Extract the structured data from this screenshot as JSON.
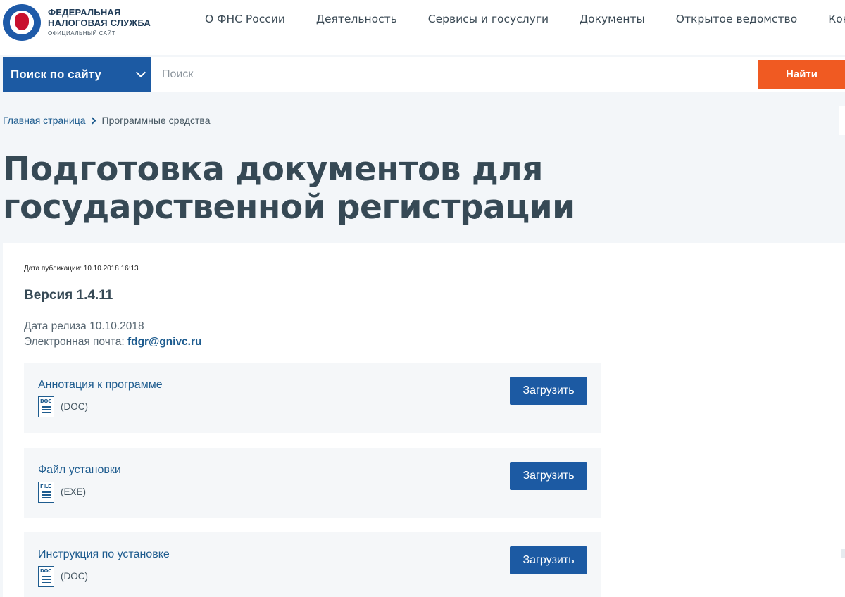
{
  "header": {
    "logo_line1": "ФЕДЕРАЛЬНАЯ",
    "logo_line2": "НАЛОГОВАЯ СЛУЖБА",
    "logo_line3": "ОФИЦИАЛЬНЫЙ САЙТ",
    "nav": [
      "О ФНС России",
      "Деятельность",
      "Сервисы и госуслуги",
      "Документы",
      "Открытое ведомство",
      "Контакты"
    ]
  },
  "search": {
    "scope_label": "Поиск по сайту",
    "placeholder": "Поиск",
    "button_label": "Найти"
  },
  "breadcrumb": {
    "home": "Главная страница",
    "current": "Программные средства"
  },
  "page": {
    "title": "Подготовка документов для государственной регистрации",
    "publication_date": "Дата публикации: 10.10.2018 16:13",
    "version": "Версия 1.4.11",
    "release_date": "Дата релиза 10.10.2018",
    "email_label": "Электронная почта:",
    "email": "fdgr@gnivc.ru"
  },
  "files": [
    {
      "name": "Аннотация к программе",
      "icon_tag": "DOC",
      "ext": "(DOC)",
      "button": "Загрузить"
    },
    {
      "name": "Файл установки",
      "icon_tag": "FILE",
      "ext": "(EXE)",
      "button": "Загрузить"
    },
    {
      "name": "Инструкция по установке",
      "icon_tag": "DOC",
      "ext": "(DOC)",
      "button": "Загрузить"
    }
  ],
  "colors": {
    "primary": "#1c5aa3",
    "accent": "#f05a22",
    "link": "#1e5c8f"
  }
}
